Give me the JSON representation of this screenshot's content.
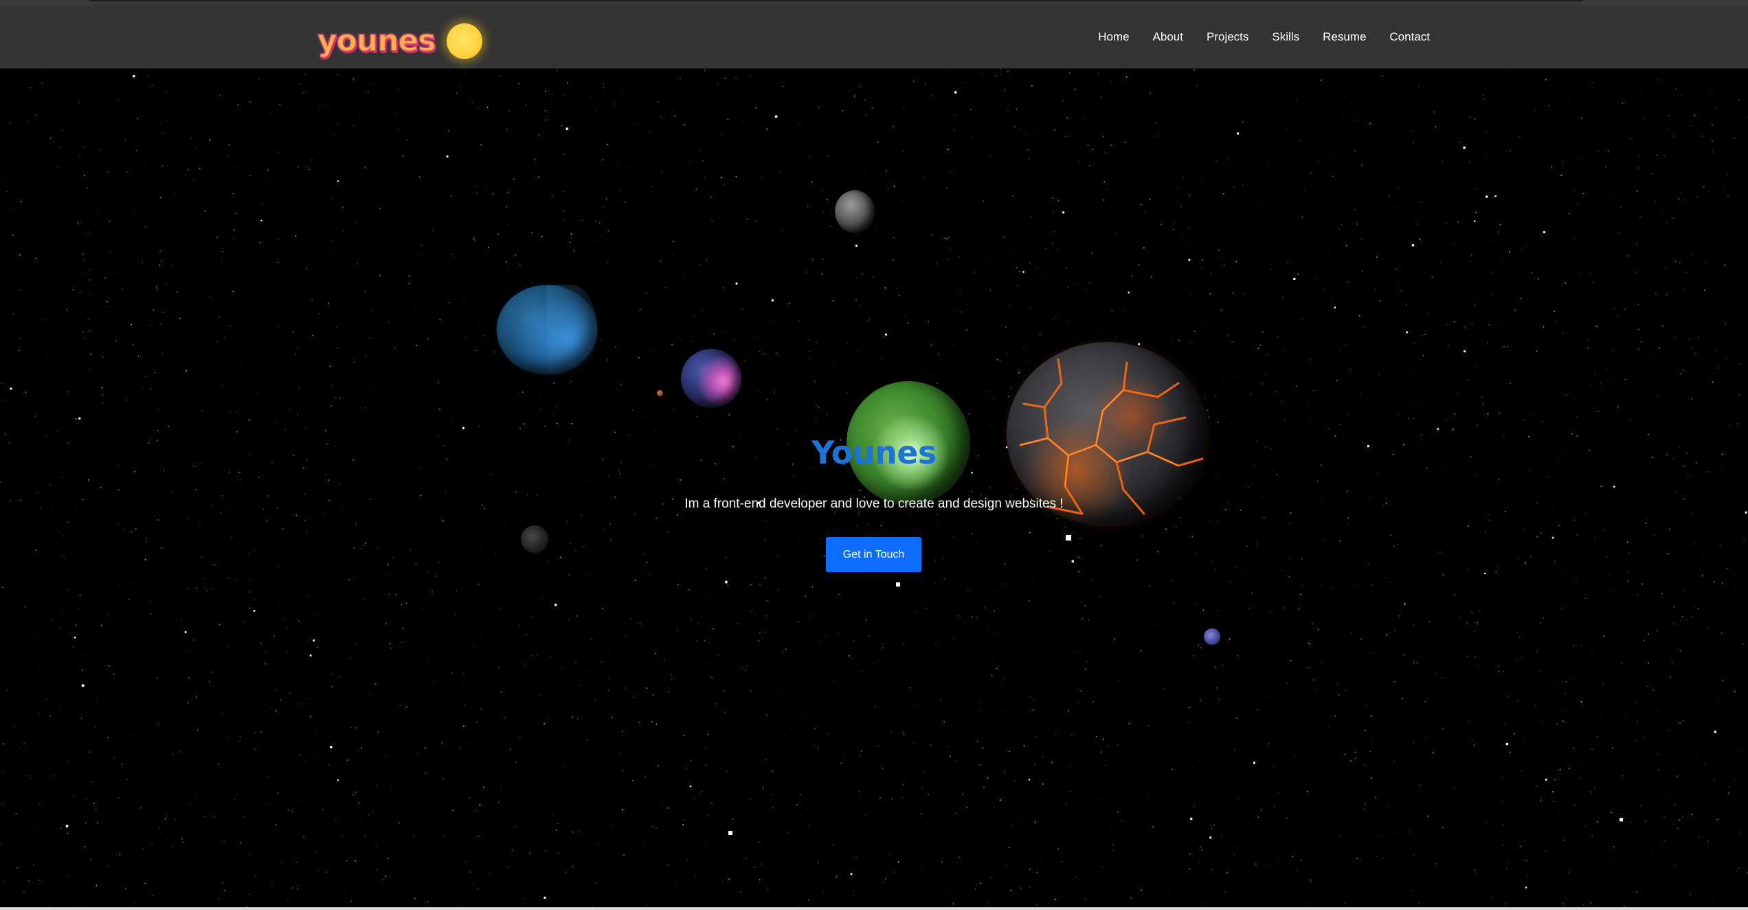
{
  "brand": {
    "name": "younes",
    "icon": "sun-icon"
  },
  "nav": {
    "items": [
      {
        "label": "Home"
      },
      {
        "label": "About"
      },
      {
        "label": "Projects"
      },
      {
        "label": "Skills"
      },
      {
        "label": "Resume"
      },
      {
        "label": "Contact"
      }
    ]
  },
  "hero": {
    "title": "Younes",
    "subtitle": "Im a front-end developer and love to create and design websites !",
    "cta_label": "Get in Touch"
  },
  "colors": {
    "navbar_bg": "#333333",
    "page_bg": "#000000",
    "title": "#1c73d8",
    "cta_bg": "#0d6efd",
    "brand_fill": "#ffb14a",
    "brand_stroke": "#e0407c",
    "sun": "#ffd23e"
  }
}
